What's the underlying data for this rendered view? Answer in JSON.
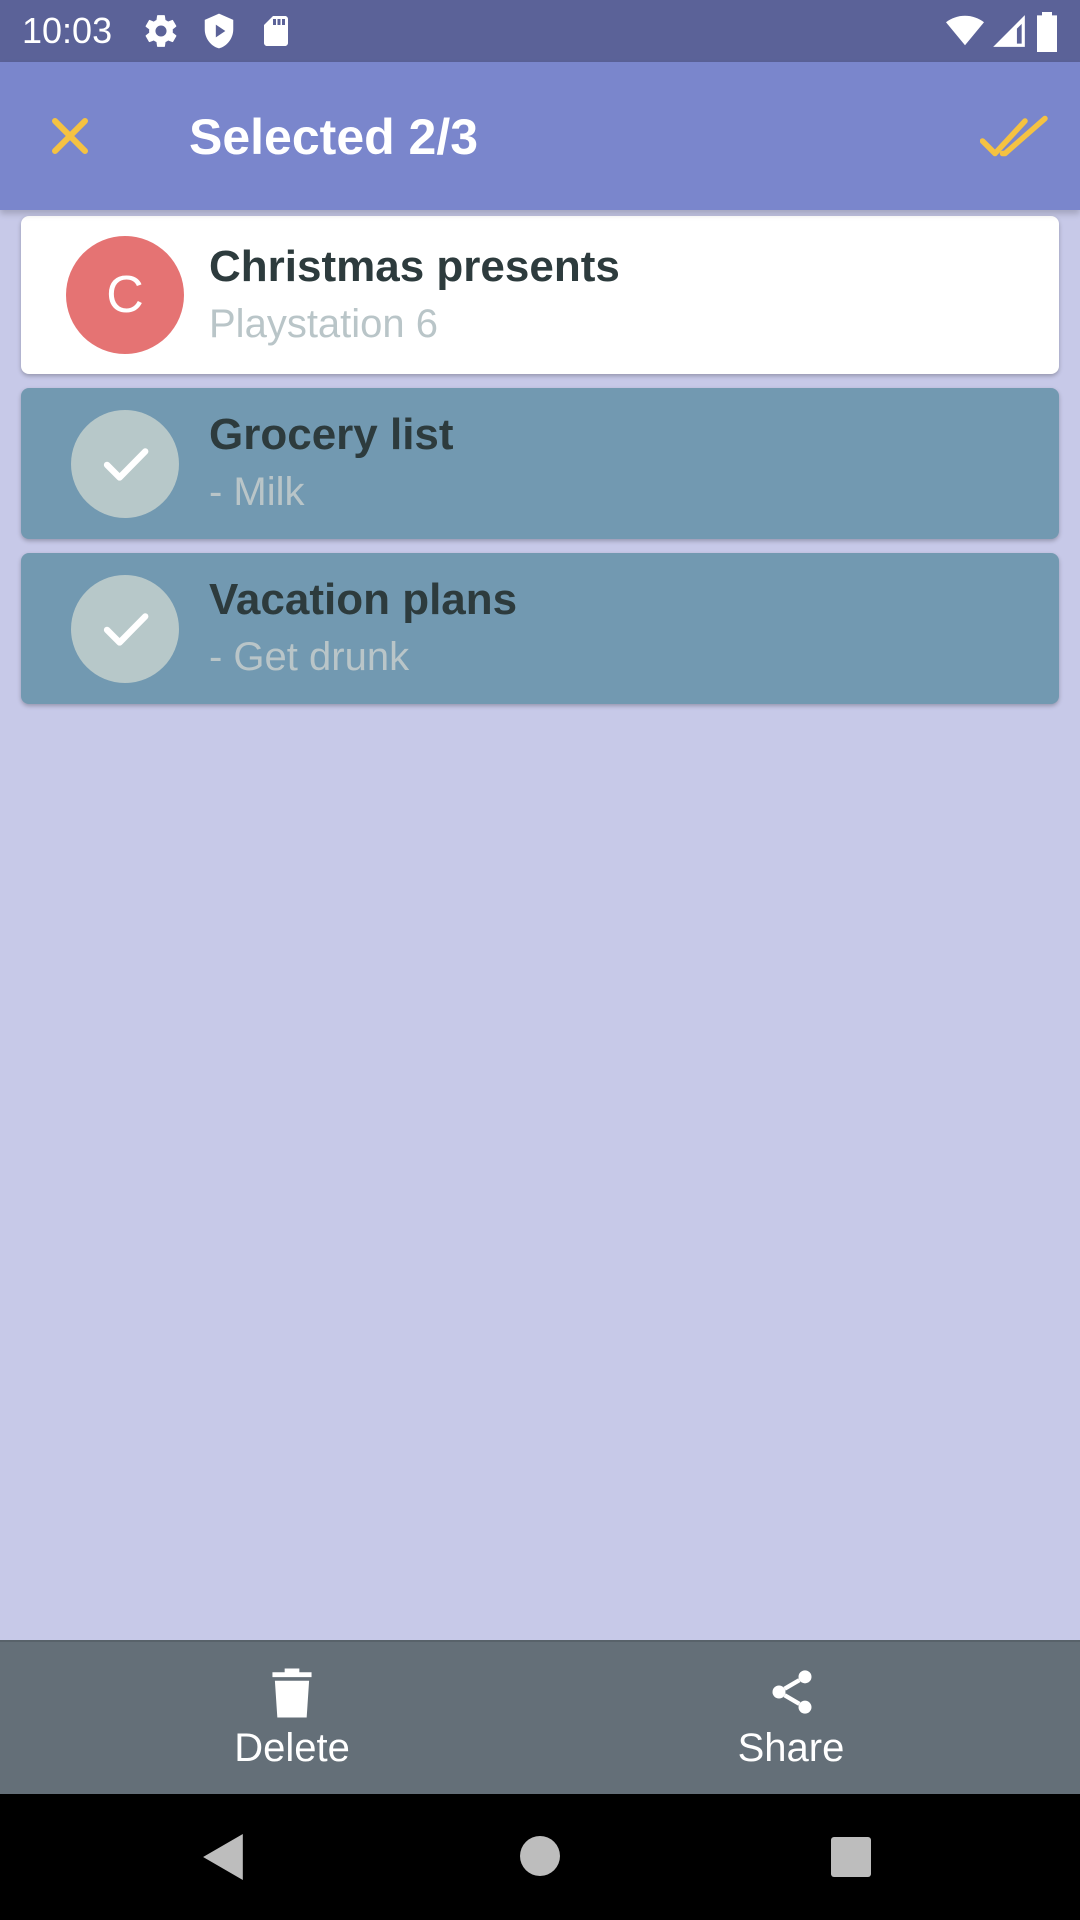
{
  "status_bar": {
    "time": "10:03",
    "icons": [
      "gear-icon",
      "shield-icon",
      "sd-card-icon",
      "wifi-icon",
      "signal-icon",
      "battery-icon"
    ]
  },
  "app_bar": {
    "title": "Selected 2/3",
    "close_icon": "close-icon",
    "select_all_icon": "double-check-icon",
    "accent_color": "#f5c242"
  },
  "notes": [
    {
      "title": "Christmas presents",
      "subtitle": "Playstation 6",
      "avatar_letter": "C",
      "selected": false
    },
    {
      "title": "Grocery list",
      "subtitle": "- Milk",
      "selected": true
    },
    {
      "title": "Vacation plans",
      "subtitle": "- Get drunk",
      "selected": true
    }
  ],
  "bottom_actions": {
    "delete_label": "Delete",
    "share_label": "Share"
  },
  "colors": {
    "status_bar": "#5b6298",
    "app_bar": "#7a86cc",
    "background": "#c7c9e8",
    "selected_card": "#7299b1",
    "avatar": "#e57373",
    "bottom_bar": "#646f78"
  }
}
